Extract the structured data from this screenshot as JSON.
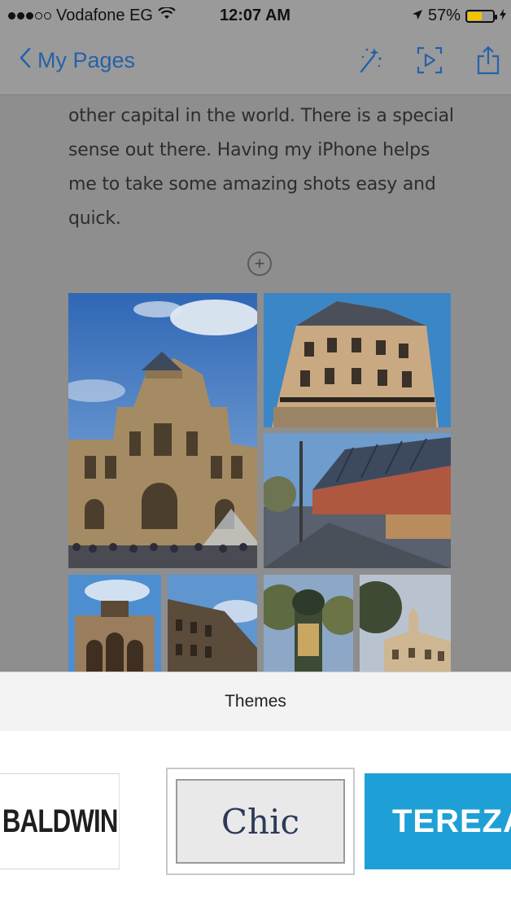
{
  "status_bar": {
    "carrier": "Vodafone EG",
    "time": "12:07 AM",
    "battery": "57%",
    "battery_level": 0.57,
    "battery_color": "#f2c400"
  },
  "nav": {
    "back_label": "My Pages",
    "back_icon": "chevron-left-icon",
    "actions": [
      "magic-wand-icon",
      "play-icon",
      "share-icon"
    ],
    "accent_color": "#2462a8"
  },
  "content": {
    "lines": [
      "other capital in the world. There is a special",
      "sense out there. Having my iPhone helps",
      "me to take some amazing shots easy and",
      "quick."
    ],
    "add_symbol": "+"
  },
  "photos": [
    {
      "subject": "Louvre palace facade"
    },
    {
      "subject": "Parisian apartment building"
    },
    {
      "subject": "Street with glass canopy"
    },
    {
      "subject": "Arc de Triomphe du Carrousel"
    },
    {
      "subject": "Louvre wing"
    },
    {
      "subject": "Morris column"
    },
    {
      "subject": "Historic building with trees"
    }
  ],
  "themes_sheet": {
    "title": "Themes",
    "themes": [
      {
        "name": "BALDWIN",
        "selected": false
      },
      {
        "name": "Chic",
        "selected": true
      },
      {
        "name": "TEREZA",
        "selected": false,
        "color": "#1ea0d6"
      }
    ]
  }
}
